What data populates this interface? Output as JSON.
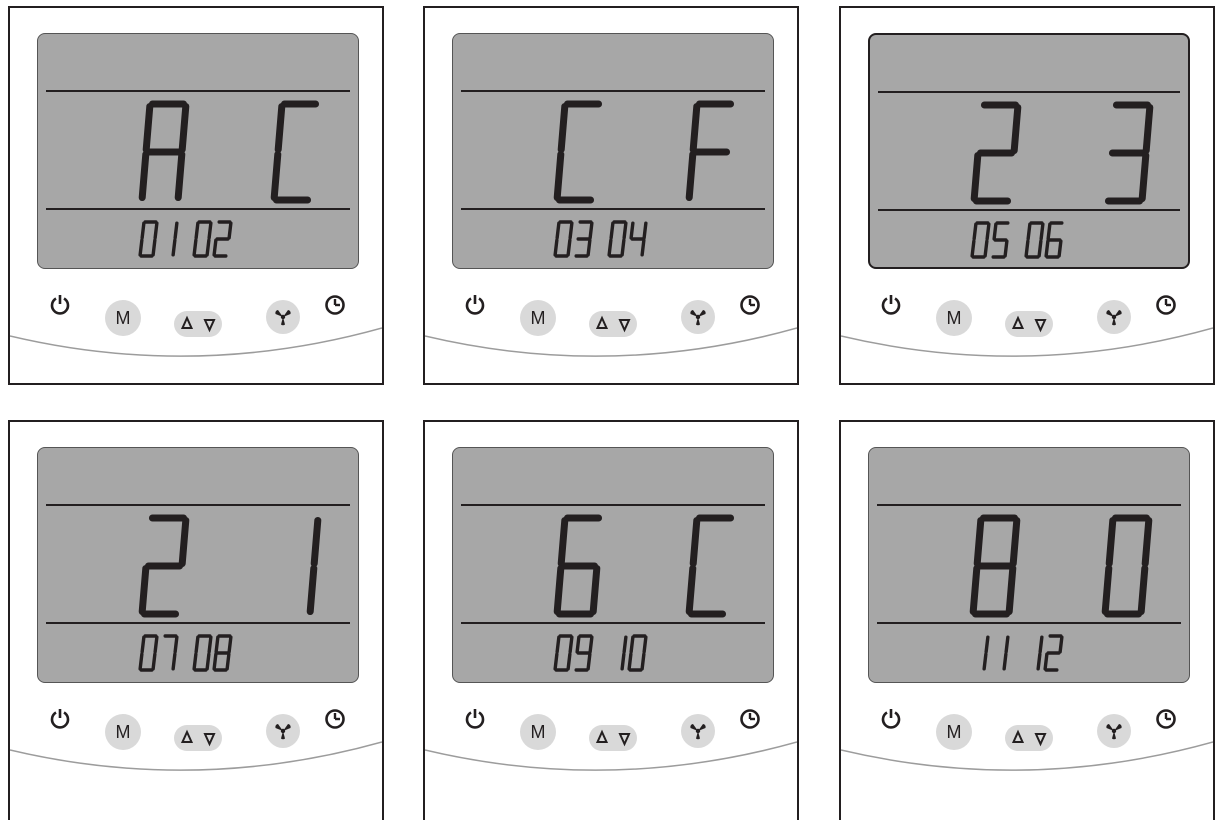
{
  "panels": [
    {
      "big_left": "A",
      "big_right": "C",
      "small_code": "0102"
    },
    {
      "big_left": "C",
      "big_right": "F",
      "small_code": "0304"
    },
    {
      "big_left": "2",
      "big_right": "3",
      "small_code": "0506"
    },
    {
      "big_left": "2",
      "big_right": "1",
      "small_code": "0708"
    },
    {
      "big_left": "6",
      "big_right": "C",
      "small_code": "0910"
    },
    {
      "big_left": "8",
      "big_right": "0",
      "small_code": "1112"
    }
  ],
  "buttons": {
    "mode_label": "M",
    "power_icon": "power-icon",
    "up_icon": "up-triangle-icon",
    "down_icon": "down-triangle-icon",
    "fan_icon": "fan-icon",
    "timer_icon": "clock-icon"
  },
  "colors": {
    "lcd": "#a7a7a7",
    "segment": "#231f20",
    "button": "#d9d9d9"
  }
}
